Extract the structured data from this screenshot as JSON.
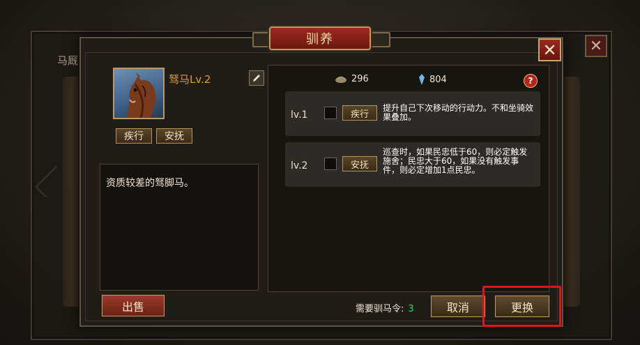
{
  "background": {
    "title": "马厩",
    "close_glyph": "✕"
  },
  "dialog": {
    "title": "驯养",
    "close_glyph": "✕"
  },
  "horse": {
    "name": "驽马Lv.2",
    "tags": [
      "疾行",
      "安抚"
    ],
    "description": "资质较差的驽脚马。"
  },
  "resources": {
    "forage": "296",
    "crystal": "804",
    "help_glyph": "?"
  },
  "skills": [
    {
      "level": "lv.1",
      "button": "疾行",
      "description": "提升自己下次移动的行动力。不和坐骑效果叠加。"
    },
    {
      "level": "lv.2",
      "button": "安抚",
      "description": "巡查时，如果民忠低于60，则必定触发施舍；民忠大于60，如果没有触发事件，则必定增加1点民忠。"
    }
  ],
  "footer": {
    "sell": "出售",
    "need_label": "需要驯马令:",
    "need_value": "3",
    "cancel": "取消",
    "change": "更换"
  },
  "colors": {
    "accent_red": "#e0141a",
    "name_orange": "#e39a32",
    "need_green": "#3fd84a"
  }
}
